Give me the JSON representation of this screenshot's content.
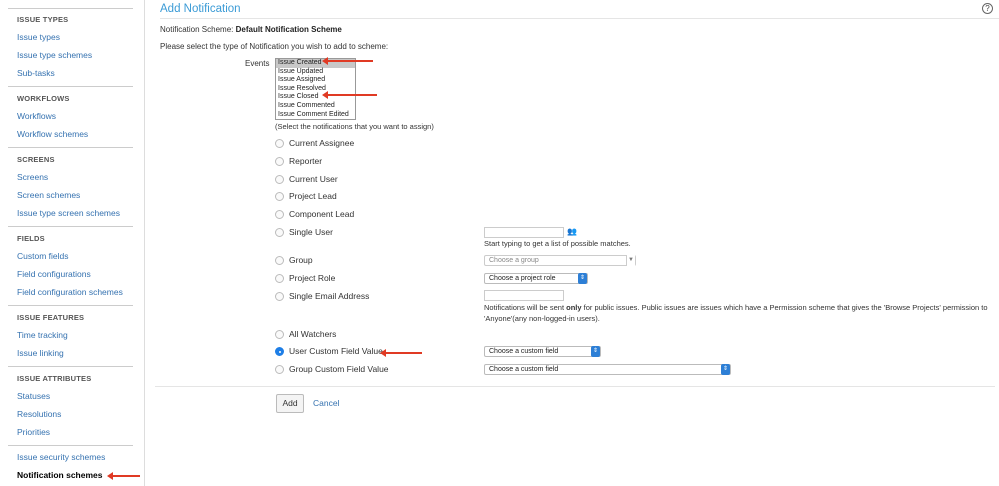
{
  "sidebar": {
    "sections": [
      {
        "heading": "ISSUE TYPES",
        "items": [
          "Issue types",
          "Issue type schemes",
          "Sub-tasks"
        ]
      },
      {
        "heading": "WORKFLOWS",
        "items": [
          "Workflows",
          "Workflow schemes"
        ]
      },
      {
        "heading": "SCREENS",
        "items": [
          "Screens",
          "Screen schemes",
          "Issue type screen schemes"
        ]
      },
      {
        "heading": "FIELDS",
        "items": [
          "Custom fields",
          "Field configurations",
          "Field configuration schemes"
        ]
      },
      {
        "heading": "ISSUE FEATURES",
        "items": [
          "Time tracking",
          "Issue linking"
        ]
      },
      {
        "heading": "ISSUE ATTRIBUTES",
        "items": [
          "Statuses",
          "Resolutions",
          "Priorities"
        ]
      },
      {
        "heading": "",
        "items": [
          "Issue security schemes",
          "Notification schemes"
        ]
      }
    ],
    "active_item": "Notification schemes"
  },
  "page": {
    "title": "Add Notification",
    "help_icon": "?",
    "scheme_label": "Notification Scheme:",
    "scheme_name": "Default Notification Scheme",
    "prompt": "Please select the type of Notification you wish to add to scheme:"
  },
  "events": {
    "label": "Events",
    "options": [
      "Issue Created",
      "Issue Updated",
      "Issue Assigned",
      "Issue Resolved",
      "Issue Closed",
      "Issue Commented",
      "Issue Comment Edited"
    ],
    "selected": "Issue Created",
    "hint": "(Select the notifications that you want to assign)"
  },
  "recipients": {
    "options": [
      "Current Assignee",
      "Reporter",
      "Current User",
      "Project Lead",
      "Component Lead",
      "Single User",
      "Group",
      "Project Role",
      "Single Email Address",
      "All Watchers",
      "User Custom Field Value",
      "Group Custom Field Value"
    ],
    "selected": "User Custom Field Value"
  },
  "controls": {
    "single_user_hint": "Start typing to get a list of possible matches.",
    "group_placeholder": "Choose a group",
    "project_role_value": "Choose a project role",
    "email_hint_part1": "Notifications will be sent ",
    "email_hint_only": "only",
    "email_hint_part2": " for public issues. Public issues are issues which have a Permission scheme that gives the 'Browse Projects' permission to",
    "email_hint_line2": "'Anyone'(any non-logged-in users).",
    "user_cf_value": "Choose a custom field",
    "group_cf_value": "Choose a custom field"
  },
  "actions": {
    "add_label": "Add",
    "cancel_label": "Cancel"
  },
  "annotations": {
    "arrow_color": "#e03a24"
  }
}
